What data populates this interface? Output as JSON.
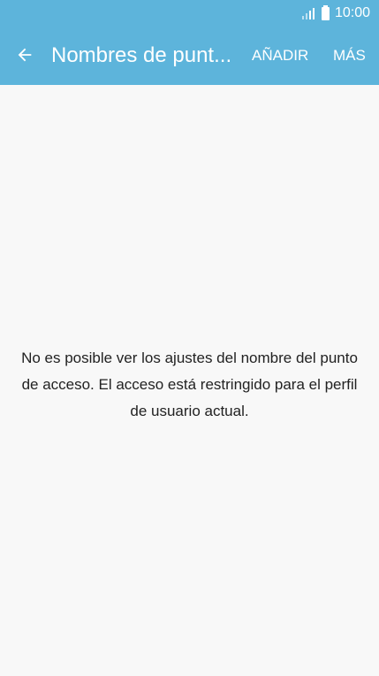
{
  "status_bar": {
    "signal_icon": "signal-bars-icon",
    "battery_icon": "battery-full-icon",
    "time": "10:00"
  },
  "header": {
    "back_icon": "arrow-left-icon",
    "title": "Nombres de punt...",
    "add_label": "AÑADIR",
    "more_label": "MÁS",
    "background_color": "#5db4db"
  },
  "main": {
    "message": "No es posible ver los ajustes del nombre del punto de acceso. El acceso está restringido para el perfil de usuario actual."
  }
}
